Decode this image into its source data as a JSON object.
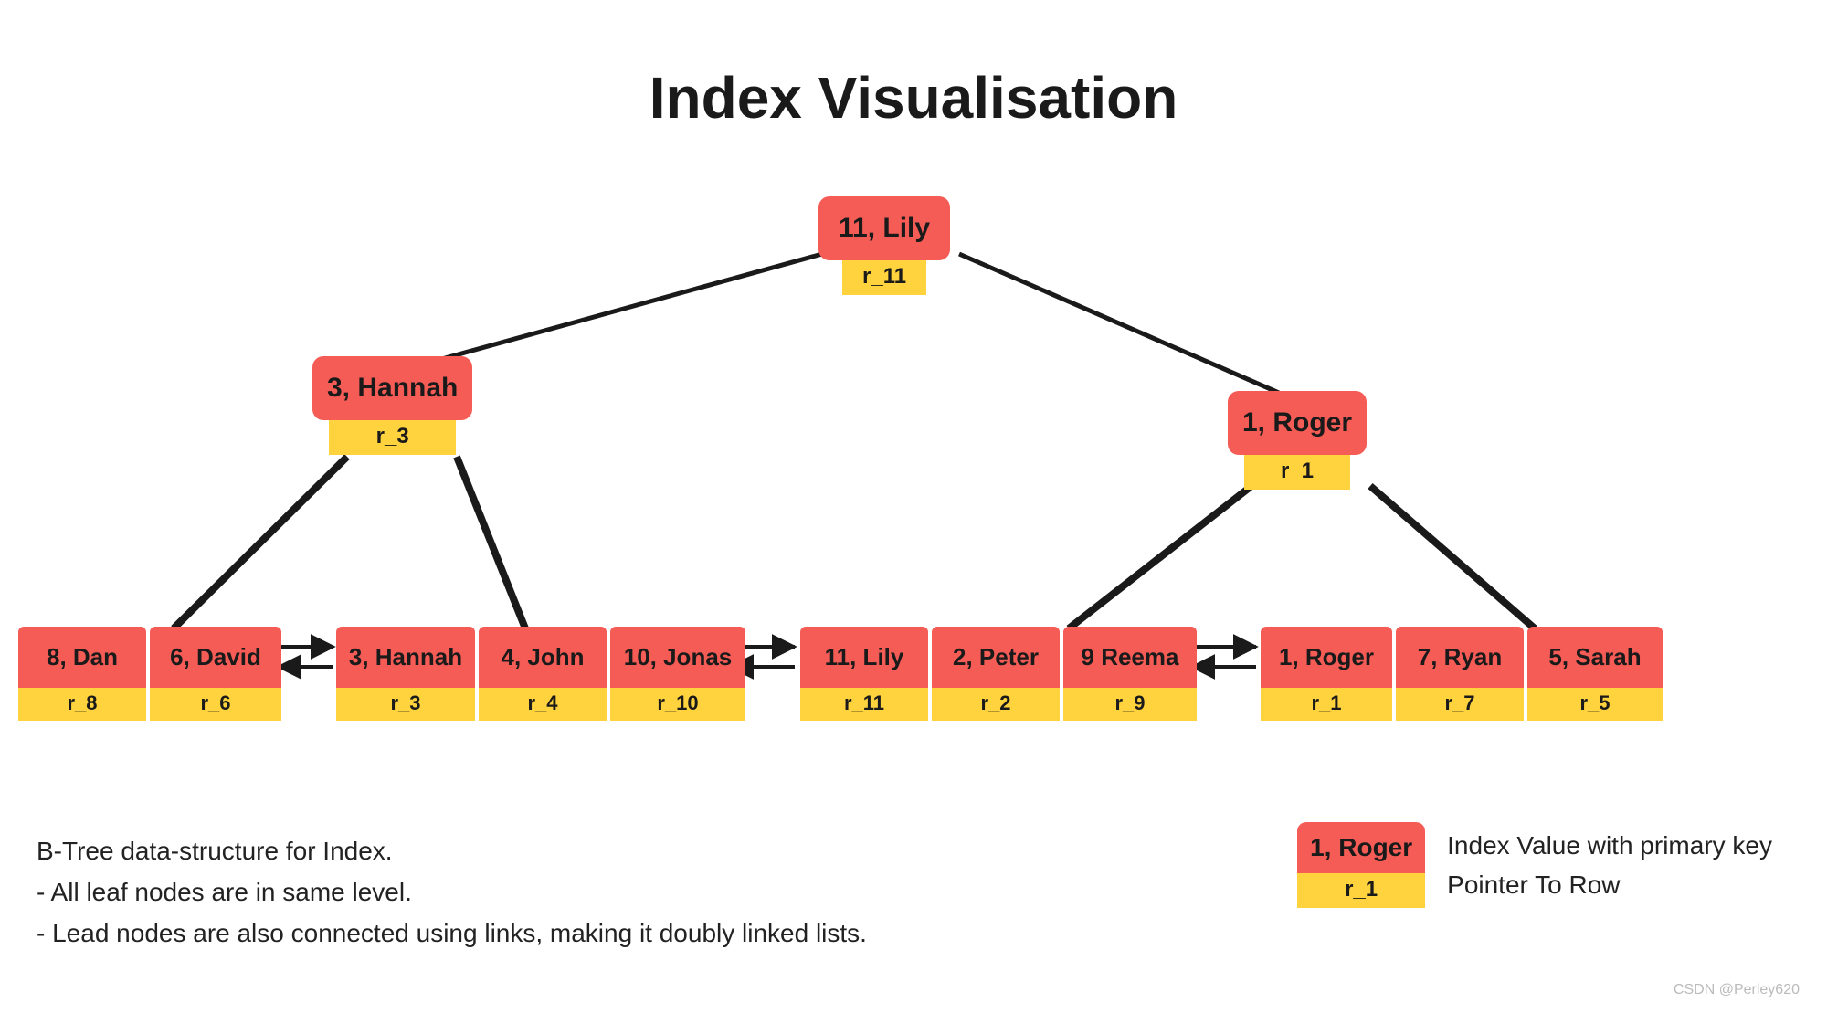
{
  "title": "Index Visualisation",
  "root": {
    "key": "11, Lily",
    "ptr": "r_11"
  },
  "mid_left": {
    "key": "3, Hannah",
    "ptr": "r_3"
  },
  "mid_right": {
    "key": "1, Roger",
    "ptr": "r_1"
  },
  "leaves": [
    {
      "key": "8, Dan",
      "ptr": "r_8"
    },
    {
      "key": "6, David",
      "ptr": "r_6"
    },
    {
      "key": "3, Hannah",
      "ptr": "r_3"
    },
    {
      "key": "4, John",
      "ptr": "r_4"
    },
    {
      "key": "10, Jonas",
      "ptr": "r_10"
    },
    {
      "key": "11, Lily",
      "ptr": "r_11"
    },
    {
      "key": "2, Peter",
      "ptr": "r_2"
    },
    {
      "key": "9 Reema",
      "ptr": "r_9"
    },
    {
      "key": "1, Roger",
      "ptr": "r_1"
    },
    {
      "key": "7, Ryan",
      "ptr": "r_7"
    },
    {
      "key": "5, Sarah",
      "ptr": "r_5"
    }
  ],
  "caption": {
    "line1": "B-Tree data-structure for Index.",
    "line2": "- All leaf nodes are in same level.",
    "line3": "- Lead nodes are also connected using links, making it doubly linked lists."
  },
  "legend": {
    "key": "1, Roger",
    "ptr": "r_1",
    "label1": "Index Value with primary key",
    "label2": "Pointer To Row"
  },
  "watermark": "CSDN @Perley620"
}
